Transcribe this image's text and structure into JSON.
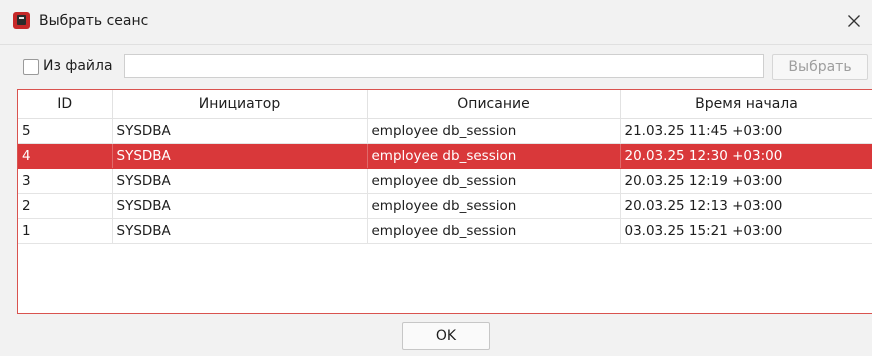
{
  "window": {
    "title": "Выбрать сеанс",
    "icon": "database-icon",
    "close_icon": "close-icon"
  },
  "from_file": {
    "checkbox_label": "Из файла",
    "checked": false,
    "path_value": "",
    "choose_button": "Выбрать"
  },
  "table": {
    "columns": [
      "ID",
      "Инициатор",
      "Описание",
      "Время начала"
    ],
    "rows": [
      {
        "id": "5",
        "initiator": "SYSDBA",
        "description": "employee db_session",
        "start_time": "21.03.25 11:45 +03:00",
        "selected": false
      },
      {
        "id": "4",
        "initiator": "SYSDBA",
        "description": "employee db_session",
        "start_time": "20.03.25 12:30 +03:00",
        "selected": true
      },
      {
        "id": "3",
        "initiator": "SYSDBA",
        "description": "employee db_session",
        "start_time": "20.03.25 12:19 +03:00",
        "selected": false
      },
      {
        "id": "2",
        "initiator": "SYSDBA",
        "description": "employee db_session",
        "start_time": "20.03.25 12:13 +03:00",
        "selected": false
      },
      {
        "id": "1",
        "initiator": "SYSDBA",
        "description": "employee db_session",
        "start_time": "03.03.25 15:21 +03:00",
        "selected": false
      }
    ]
  },
  "ok_button": "OK",
  "colors": {
    "selection": "#d9383a",
    "accent_border": "#d9534f"
  }
}
